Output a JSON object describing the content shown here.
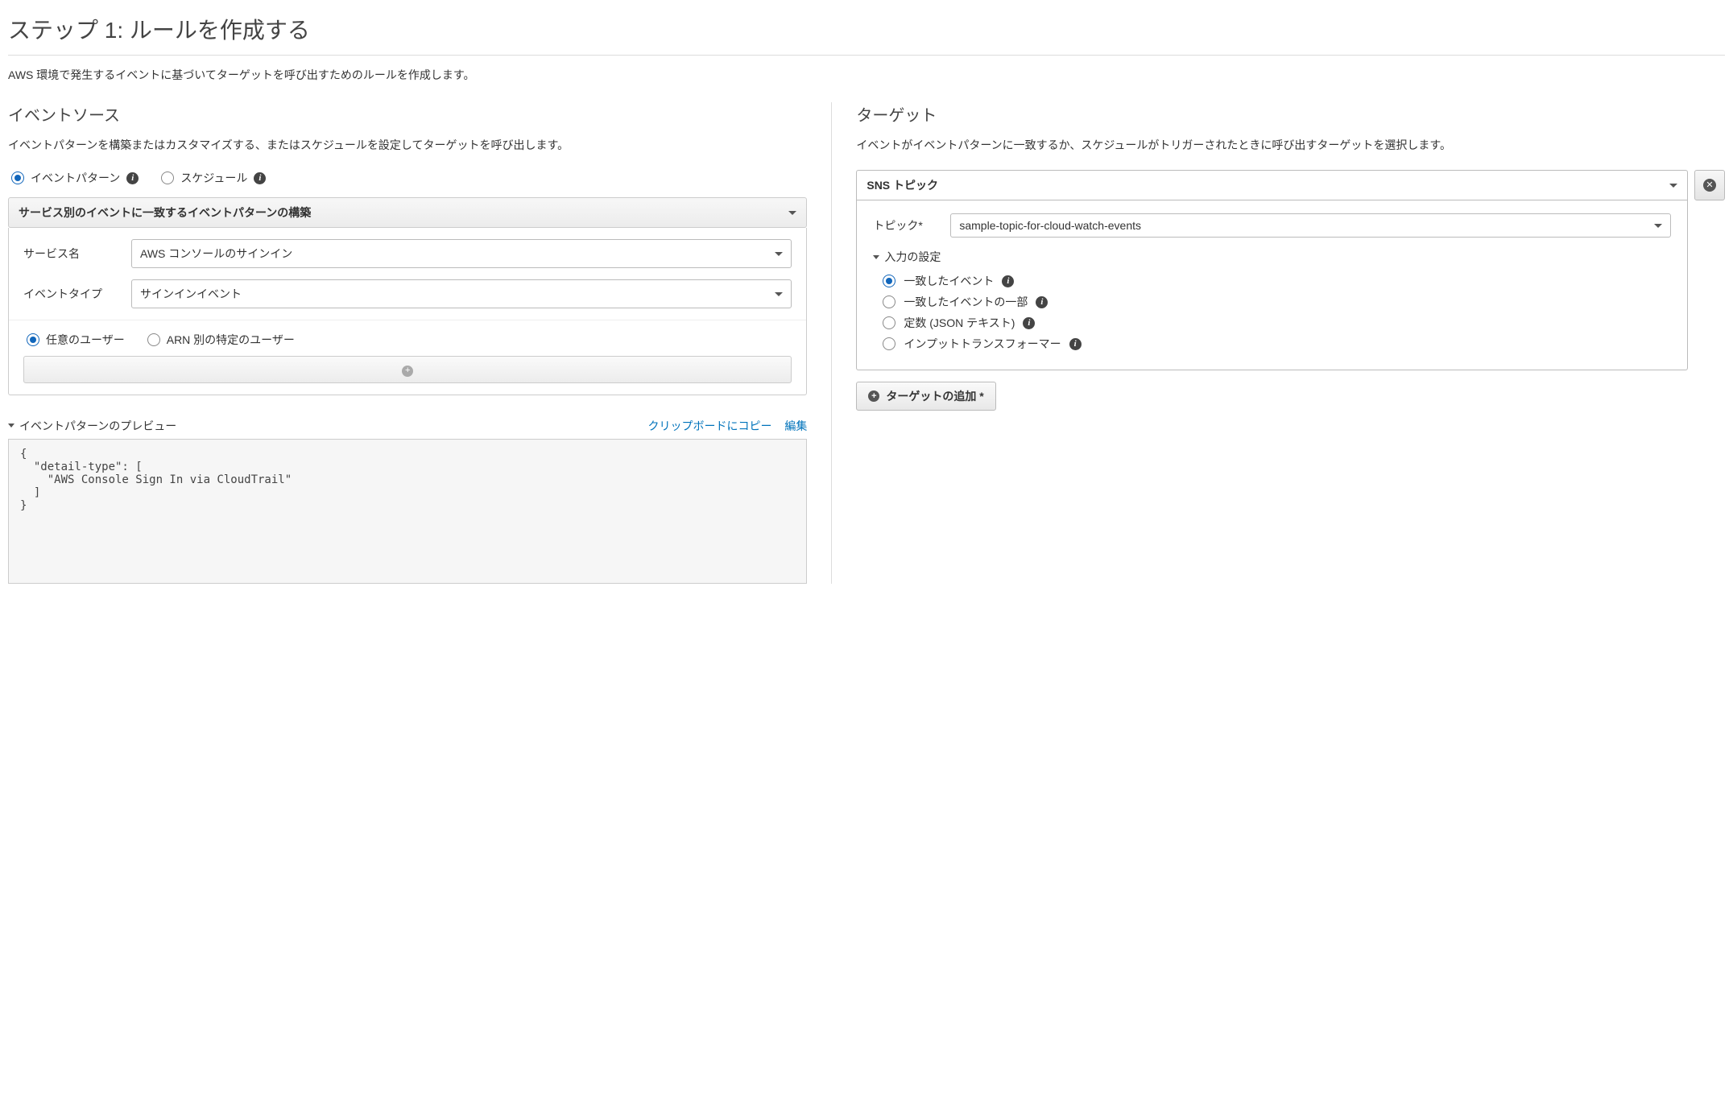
{
  "page": {
    "title": "ステップ 1: ルールを作成する",
    "description": "AWS 環境で発生するイベントに基づいてターゲットを呼び出すためのルールを作成します。"
  },
  "eventSource": {
    "title": "イベントソース",
    "description": "イベントパターンを構築またはカスタマイズする、またはスケジュールを設定してターゲットを呼び出します。",
    "radios": {
      "pattern": "イベントパターン",
      "schedule": "スケジュール"
    },
    "panelHeader": "サービス別のイベントに一致するイベントパターンの構築",
    "serviceNameLabel": "サービス名",
    "serviceNameValue": "AWS コンソールのサインイン",
    "eventTypeLabel": "イベントタイプ",
    "eventTypeValue": "サインインイベント",
    "userRadios": {
      "any": "任意のユーザー",
      "byArn": "ARN 別の特定のユーザー"
    },
    "preview": {
      "title": "イベントパターンのプレビュー",
      "copyLink": "クリップボードにコピー",
      "editLink": "編集",
      "json": "{\n  \"detail-type\": [\n    \"AWS Console Sign In via CloudTrail\"\n  ]\n}"
    }
  },
  "targets": {
    "title": "ターゲット",
    "description": "イベントがイベントパターンに一致するか、スケジュールがトリガーされたときに呼び出すターゲットを選択します。",
    "targetType": "SNS トピック",
    "topicLabel": "トピック*",
    "topicValue": "sample-topic-for-cloud-watch-events",
    "inputConfig": {
      "title": "入力の設定",
      "options": {
        "matched": "一致したイベント",
        "partial": "一致したイベントの一部",
        "constant": "定数 (JSON テキスト)",
        "transformer": "インプットトランスフォーマー"
      }
    },
    "addTargetLabel": "ターゲットの追加 *"
  }
}
